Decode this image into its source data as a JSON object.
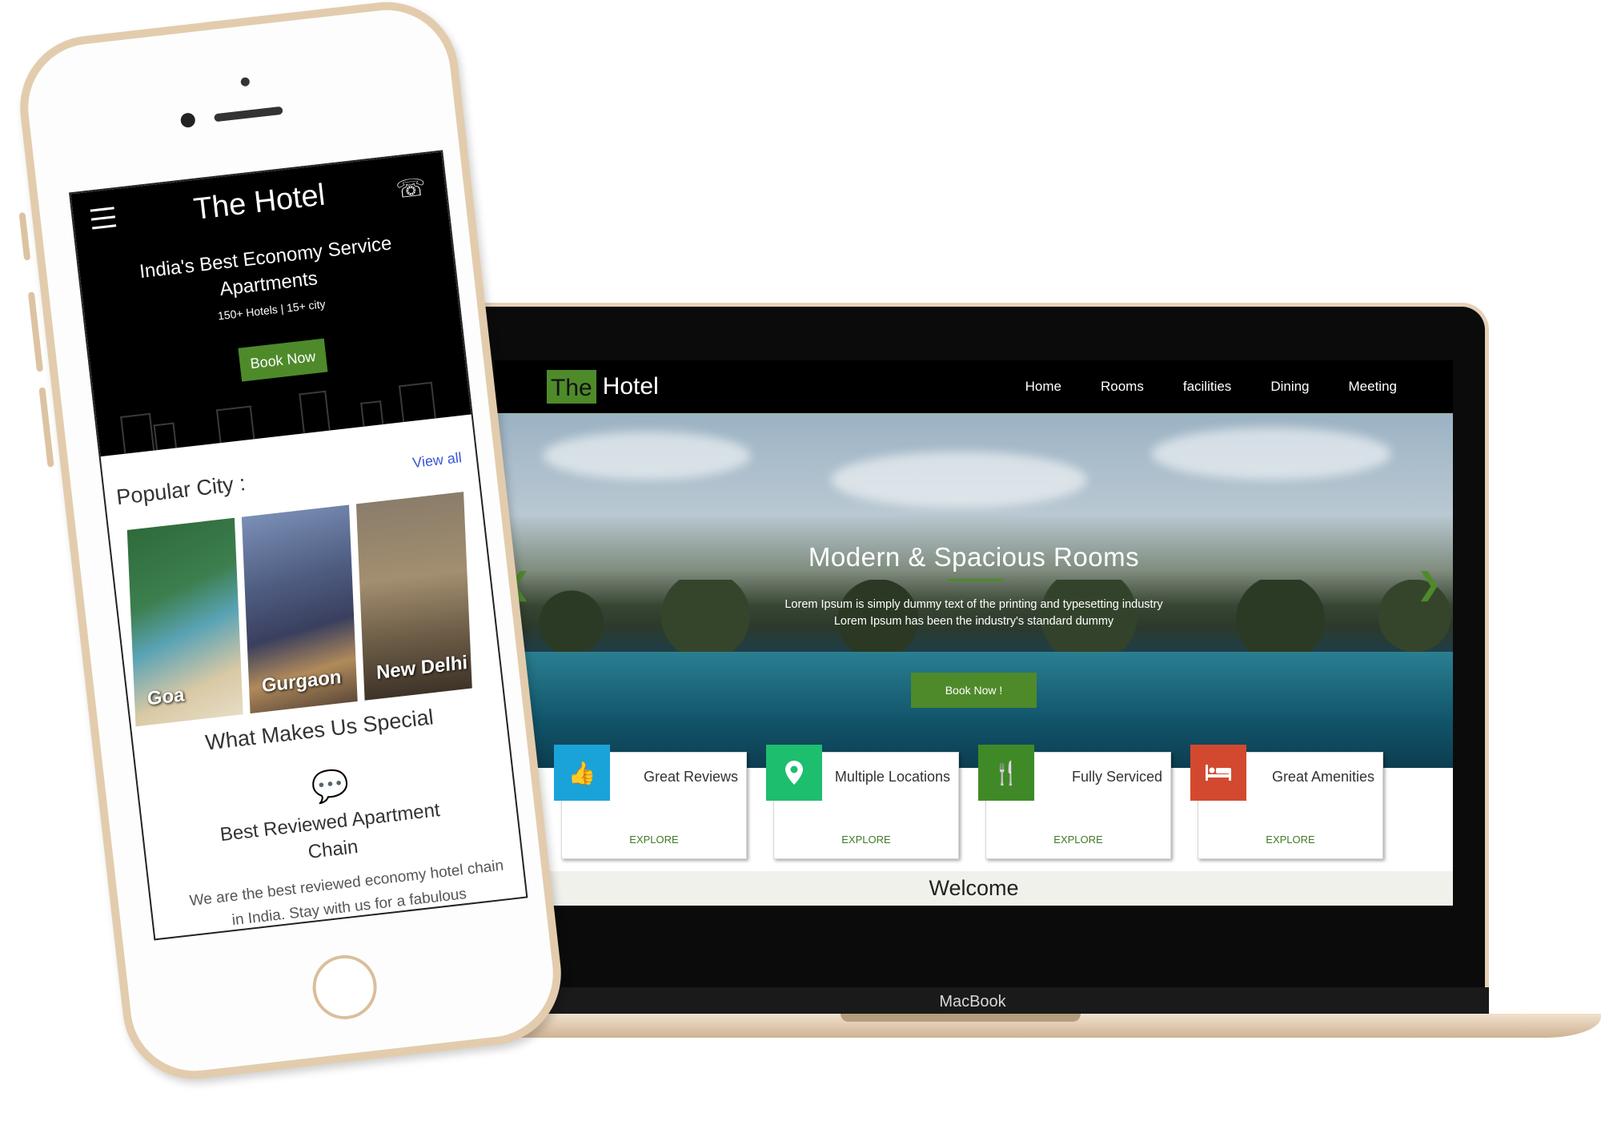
{
  "laptop": {
    "brand_label": "MacBook",
    "navbar": {
      "logo_the": "The",
      "logo_hotel": "Hotel",
      "links": [
        "Home",
        "Rooms",
        "facilities",
        "Dining",
        "Meeting"
      ]
    },
    "hero": {
      "title": "Modern & Spacious Rooms",
      "subtitle_line1": "Lorem Ipsum is simply dummy text of the printing and typesetting industry",
      "subtitle_line2": "Lorem Ipsum has been the industry's standard dummy",
      "cta": "Book Now !",
      "prev_icon": "chevron-left-icon",
      "next_icon": "chevron-right-icon"
    },
    "features": [
      {
        "title": "Great Reviews",
        "action": "EXPLORE",
        "icon": "thumbs-up-icon",
        "color": "#1aa3d9"
      },
      {
        "title": "Multiple Locations",
        "action": "EXPLORE",
        "icon": "map-pin-icon",
        "color": "#1dbe6e"
      },
      {
        "title": "Fully Serviced",
        "action": "EXPLORE",
        "icon": "utensils-icon",
        "color": "#3f8a26"
      },
      {
        "title": "Great Amenities",
        "action": "EXPLORE",
        "icon": "bed-icon",
        "color": "#d3492f"
      }
    ],
    "welcome": "Welcome"
  },
  "phone": {
    "logo": "The Hotel",
    "tagline_line1": "India's Best Economy Service",
    "tagline_line2": "Apartments",
    "stats": "150+ Hotels | 15+ city",
    "cta": "Book Now",
    "popular_label": "Popular City :",
    "view_all": "View all",
    "cities": [
      "Goa",
      "Gurgaon",
      "New Delhi"
    ],
    "special_title": "What Makes Us Special",
    "feature_title_line1": "Best Reviewed Apartment",
    "feature_title_line2": "Chain",
    "feature_desc": "We are the best reviewed economy hotel chain in India. Stay with us for a fabulous"
  },
  "colors": {
    "accent_green": "#4e8a2a",
    "link_blue": "#3a57d8"
  }
}
